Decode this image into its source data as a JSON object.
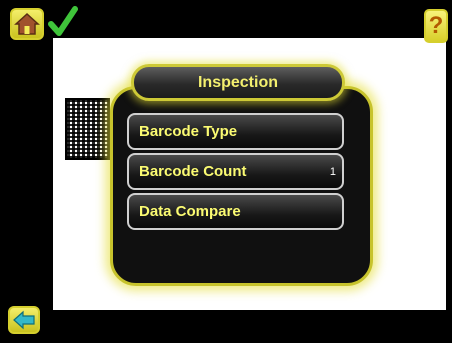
{
  "header": {
    "home_icon": "home-icon",
    "status_icon": "checkmark-icon",
    "help_icon": "question-mark-icon",
    "help_label": "?"
  },
  "inspection_menu": {
    "title": "Inspection",
    "items": [
      {
        "label": "Barcode Type",
        "value": ""
      },
      {
        "label": "Barcode Count",
        "value": "1"
      },
      {
        "label": "Data Compare",
        "value": ""
      }
    ]
  },
  "footer": {
    "back_icon": "back-arrow-icon"
  },
  "colors": {
    "accent_yellow": "#f3ef6f",
    "glow": "#e4de37",
    "background": "#000000",
    "viewport": "#ffffff"
  }
}
